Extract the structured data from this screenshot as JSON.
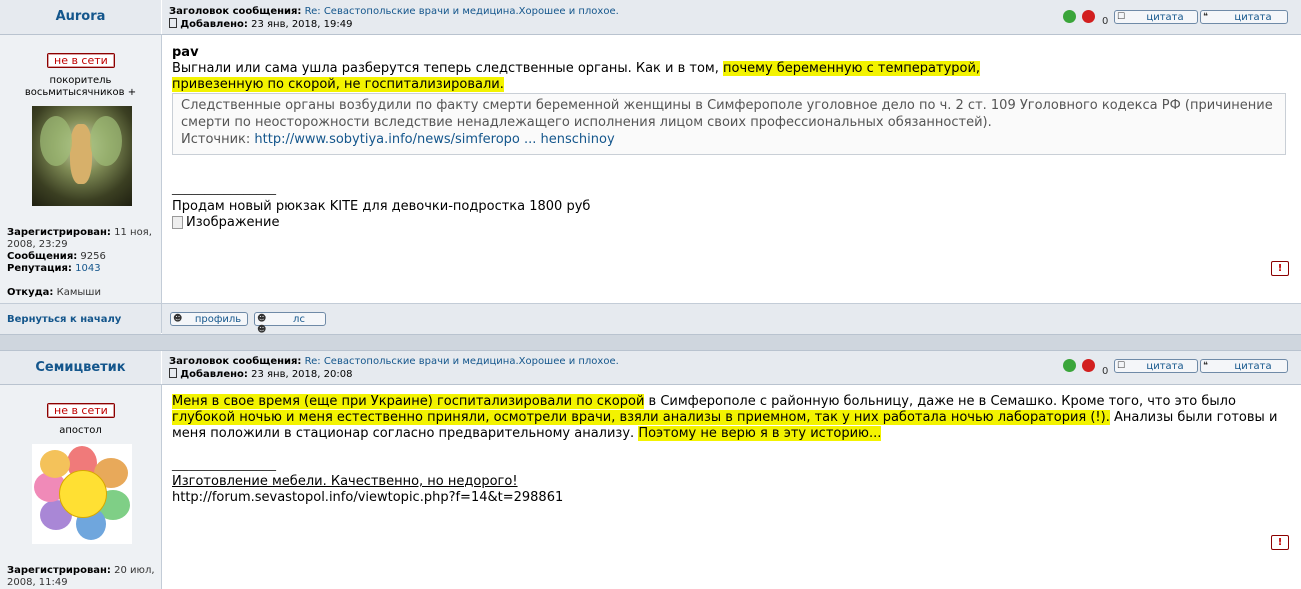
{
  "posts": [
    {
      "author": "Aurora",
      "status": "не в сети",
      "rank": "покоритель восьмитысячников +",
      "subject_label": "Заголовок сообщения:",
      "subject": "Re: Севастопольские врачи и медицина.Хорошее и плохое.",
      "posted_label": "Добавлено:",
      "posted": "23 янв, 2018, 19:49",
      "vote_count": "0",
      "quote_btn": "цитата",
      "quote_btn2": "цитата",
      "quoted_author": "pav",
      "text_part1": "Выгнали или сама ушла разберутся теперь следственные органы. Как и в том, ",
      "text_highlight1": "почему беременную с температурой, привезенную по скорой, не госпитализировали.",
      "quote_text": "Следственные органы возбудили по факту смерти беременной женщины в Симферополе уголовное дело по ч. 2 ст. 109 Уголовного кодекса РФ (причинение смерти по неосторожности вследствие ненадлежащего исполнения лицом своих профессиональных обязанностей).",
      "source_label": "Источник: ",
      "source_link": "http://www.sobytiya.info/news/simferopo ... henschinoy",
      "sig_line": "________________",
      "sig_text": "Продам новый рюкзак KITE для девочки-подростка 1800 руб",
      "sig_image_alt": "Изображение",
      "reg_label": "Зарегистрирован:",
      "reg_value": "11 ноя, 2008, 23:29",
      "msgs_label": "Сообщения:",
      "msgs_value": "9256",
      "rep_label": "Репутация:",
      "rep_value": "1043",
      "from_label": "Откуда:",
      "from_value": "Камыши",
      "back_to_top": "Вернуться к началу",
      "profile_btn": "профиль",
      "pm_btn": "лс"
    },
    {
      "author": "Семицветик",
      "status": "не в сети",
      "rank": "апостол",
      "subject_label": "Заголовок сообщения:",
      "subject": "Re: Севастопольские врачи и медицина.Хорошее и плохое.",
      "posted_label": "Добавлено:",
      "posted": "23 янв, 2018, 20:08",
      "vote_count": "0",
      "quote_btn": "цитата",
      "quote_btn2": "цитата",
      "text_h1": "Меня в свое время (еще при Украине) госпитализировали по скорой",
      "text_n1": " в Симферополе с районную больницу, даже не в Семашко. Кроме того, что это было ",
      "text_h2": "глубокой ночью и меня естественно приняли, осмотрели врачи, взяли анализы в приемном, так у них работала ночью лаборатория (!).",
      "text_n2": " Анализы были готовы и меня положили в стационар согласно предварительному анализу. ",
      "text_h3": "Поэтому не верю я в эту историю...",
      "sig_line": "________________",
      "sig_text": "Изготовление мебели. Качественно, но недорого! ",
      "sig_url": "http://forum.sevastopol.info/viewtopic.php?f=14&t=298861",
      "reg_label": "Зарегистрирован:",
      "reg_value": "20 июл, 2008, 11:49"
    }
  ],
  "colors": {
    "accent": "#14568c",
    "highlight": "#f3f300",
    "header_bg": "#e6eaef"
  }
}
